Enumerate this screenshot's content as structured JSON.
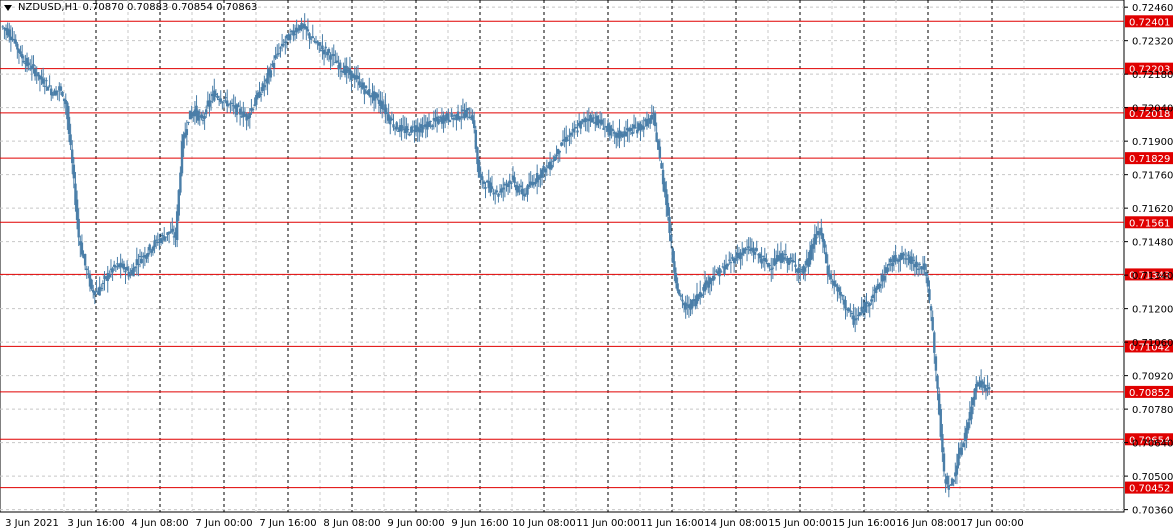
{
  "header": {
    "symbol_tf": "NZDUSD,H1",
    "ohlc": "0.70870 0.70883 0.70854 0.70863"
  },
  "chart_data": {
    "type": "candlestick",
    "symbol": "NZDUSD",
    "timeframe": "H1",
    "ylim": [
      0.7035,
      0.7249
    ],
    "y_ticks": [
      "0.72460",
      "0.72320",
      "0.72180",
      "0.72040",
      "0.71900",
      "0.71760",
      "0.71620",
      "0.71480",
      "0.71340",
      "0.71200",
      "0.71060",
      "0.70920",
      "0.70780",
      "0.70640",
      "0.70500",
      "0.70360"
    ],
    "x_ticks": [
      "3 Jun 2021",
      "3 Jun 16:00",
      "4 Jun 08:00",
      "7 Jun 00:00",
      "7 Jun 16:00",
      "8 Jun 08:00",
      "9 Jun 00:00",
      "9 Jun 16:00",
      "10 Jun 08:00",
      "11 Jun 00:00",
      "11 Jun 16:00",
      "14 Jun 08:00",
      "15 Jun 00:00",
      "15 Jun 16:00",
      "16 Jun 08:00",
      "17 Jun 00:00"
    ],
    "horizontal_levels": [
      "0.72401",
      "0.72203",
      "0.72018",
      "0.71829",
      "0.71561",
      "0.71343",
      "0.71042",
      "0.70852",
      "0.70654",
      "0.70452"
    ],
    "price_path": [
      0.7238,
      0.7236,
      0.7232,
      0.7226,
      0.7222,
      0.722,
      0.7216,
      0.7214,
      0.721,
      0.7212,
      0.7206,
      0.718,
      0.715,
      0.7138,
      0.7128,
      0.7127,
      0.7132,
      0.7136,
      0.7138,
      0.7137,
      0.7134,
      0.714,
      0.7142,
      0.7145,
      0.7148,
      0.715,
      0.7152,
      0.715,
      0.7188,
      0.72,
      0.7203,
      0.7198,
      0.7205,
      0.721,
      0.7208,
      0.7206,
      0.7204,
      0.7202,
      0.72,
      0.7205,
      0.721,
      0.7215,
      0.7222,
      0.7228,
      0.7232,
      0.7235,
      0.7238,
      0.7237,
      0.7233,
      0.723,
      0.7228,
      0.7226,
      0.7222,
      0.722,
      0.7218,
      0.7216,
      0.7212,
      0.721,
      0.7208,
      0.7205,
      0.72,
      0.7196,
      0.7195,
      0.7194,
      0.7196,
      0.7195,
      0.7197,
      0.7198,
      0.7199,
      0.72,
      0.72,
      0.7201,
      0.7202,
      0.72,
      0.7175,
      0.7172,
      0.717,
      0.7168,
      0.7172,
      0.7174,
      0.717,
      0.7168,
      0.7172,
      0.7175,
      0.7178,
      0.718,
      0.7185,
      0.719,
      0.7192,
      0.7195,
      0.7198,
      0.72,
      0.7199,
      0.7197,
      0.7195,
      0.7192,
      0.7193,
      0.7194,
      0.7195,
      0.7196,
      0.7198,
      0.72,
      0.7182,
      0.7165,
      0.714,
      0.7125,
      0.712,
      0.7122,
      0.7126,
      0.713,
      0.7133,
      0.7135,
      0.7137,
      0.714,
      0.7142,
      0.7144,
      0.7145,
      0.7143,
      0.714,
      0.7138,
      0.714,
      0.7142,
      0.714,
      0.7138,
      0.7135,
      0.714,
      0.715,
      0.7152,
      0.7135,
      0.713,
      0.7125,
      0.712,
      0.7115,
      0.7118,
      0.7122,
      0.7126,
      0.713,
      0.7136,
      0.714,
      0.7142,
      0.7141,
      0.714,
      0.7138,
      0.7137,
      0.7118,
      0.7085,
      0.705,
      0.7045,
      0.7055,
      0.7065,
      0.7075,
      0.709,
      0.7088,
      0.7086
    ]
  }
}
